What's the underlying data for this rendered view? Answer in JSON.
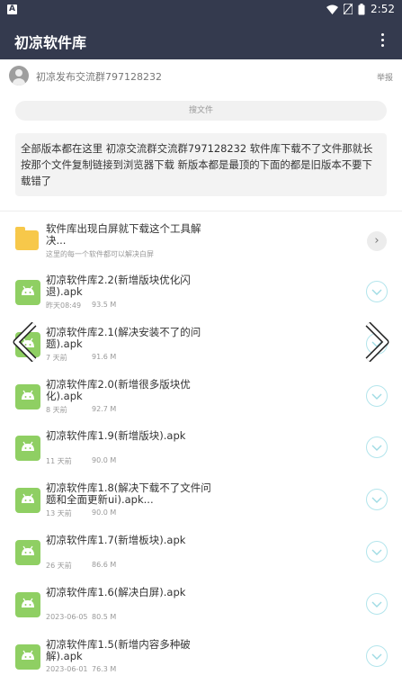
{
  "status_bar": {
    "time": "2:52",
    "app_badge": "A"
  },
  "app_bar": {
    "title": "初凉软件库"
  },
  "group": {
    "name": "初凉发布交流群797128232",
    "report": "举报"
  },
  "search": {
    "placeholder": "搜文件"
  },
  "notice": {
    "text": "全部版本都在这里 初凉交流群交流群797128232 软件库下载不了文件那就长按那个文件复制链接到浏览器下载 新版本都是最顶的下面的都是旧版本不要下载错了"
  },
  "folder": {
    "title": "软件库出现白屏就下载这个工具解决...",
    "subtitle": "这里的每一个软件都可以解决白屏"
  },
  "files": [
    {
      "name": "初凉软件库2.2(新增版块优化闪退).apk",
      "time": "昨天08:49",
      "size": "93.5 M"
    },
    {
      "name": "初凉软件库2.1(解决安装不了的问题).apk",
      "time": "7 天前",
      "size": "91.6 M"
    },
    {
      "name": "初凉软件库2.0(新增很多版块优化).apk",
      "time": "8 天前",
      "size": "92.7 M"
    },
    {
      "name": "初凉软件库1.9(新增版块).apk",
      "time": "11 天前",
      "size": "90.0 M"
    },
    {
      "name": "初凉软件库1.8(解决下载不了文件问题和全面更新ui).apk...",
      "time": "13 天前",
      "size": "90.0 M"
    },
    {
      "name": "初凉软件库1.7(新增板块).apk",
      "time": "26 天前",
      "size": "86.6 M"
    },
    {
      "name": "初凉软件库1.6(解决白屏).apk",
      "time": "2023-06-05",
      "size": "80.5 M"
    },
    {
      "name": "初凉软件库1.5(新增内容多种破解).apk",
      "time": "2023-06-01",
      "size": "76.3 M"
    }
  ]
}
